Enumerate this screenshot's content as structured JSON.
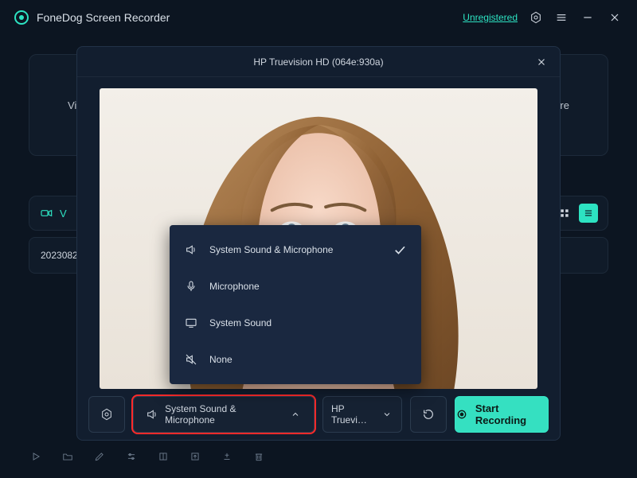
{
  "titlebar": {
    "app_name": "FoneDog Screen Recorder",
    "unregistered_label": "Unregistered"
  },
  "background": {
    "main_card_left": "Vid",
    "main_card_right": "ure",
    "tab_label": "V",
    "list_item_label": "2023082"
  },
  "modal": {
    "camera_label": "HP Truevision HD (064e:930a)",
    "footer": {
      "audio_label": "System Sound & Microphone",
      "camera_short": "HP Truevi…",
      "start_label": "Start Recording"
    }
  },
  "audio_menu": {
    "items": [
      {
        "label": "System Sound & Microphone",
        "icon": "sound-mic",
        "selected": true
      },
      {
        "label": "Microphone",
        "icon": "mic",
        "selected": false
      },
      {
        "label": "System Sound",
        "icon": "system",
        "selected": false
      },
      {
        "label": "None",
        "icon": "mute",
        "selected": false
      }
    ]
  }
}
